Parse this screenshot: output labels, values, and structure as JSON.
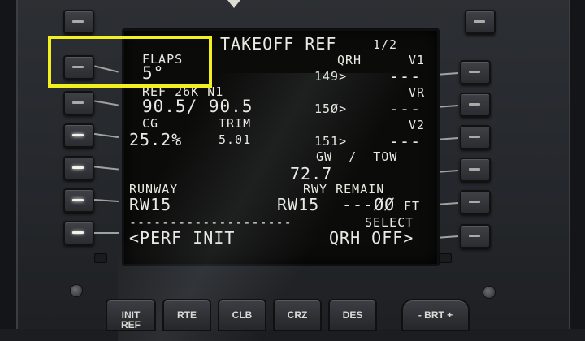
{
  "screen": {
    "title": "TAKEOFF REF",
    "page": "1/2",
    "rows": {
      "l1_label": "FLAPS",
      "l1_value": "5°",
      "l2_label": "REF 26K N1",
      "l2_value": "90.5/ 90.5",
      "l3_label_cg": "CG",
      "l3_label_trim": "TRIM",
      "l3_value_cg": "25.2%",
      "l3_value_trim": "5.01",
      "r1_label_qrh": "QRH",
      "r1_label_v1": "V1",
      "r1_qrh": "149>",
      "r1_value": "---",
      "r2_label": "VR",
      "r2_qrh": "15Ø>",
      "r2_value": "---",
      "r3_label": "V2",
      "r3_qrh": "151>",
      "r3_value": "---",
      "gw_label": "GW  /  TOW",
      "gw_value": "72.7",
      "l5_label": "RUNWAY",
      "l5_value": "RW15",
      "r5_label": "RWY REMAIN",
      "r5_value_rw": "RW15",
      "r5_value_len": "---ØØ",
      "r5_unit": "FT",
      "divider": "--------------------",
      "select_label": "SELECT",
      "l6_value": "<PERF INIT",
      "r6_value": "QRH OFF>"
    }
  },
  "keys": {
    "init_ref": "INIT\nREF",
    "rte": "RTE",
    "clb": "CLB",
    "crz": "CRZ",
    "des": "DES",
    "brt": "- BRT +"
  },
  "colors": {
    "highlight": "#f2f01e",
    "screen_text": "#e9ebe3"
  }
}
